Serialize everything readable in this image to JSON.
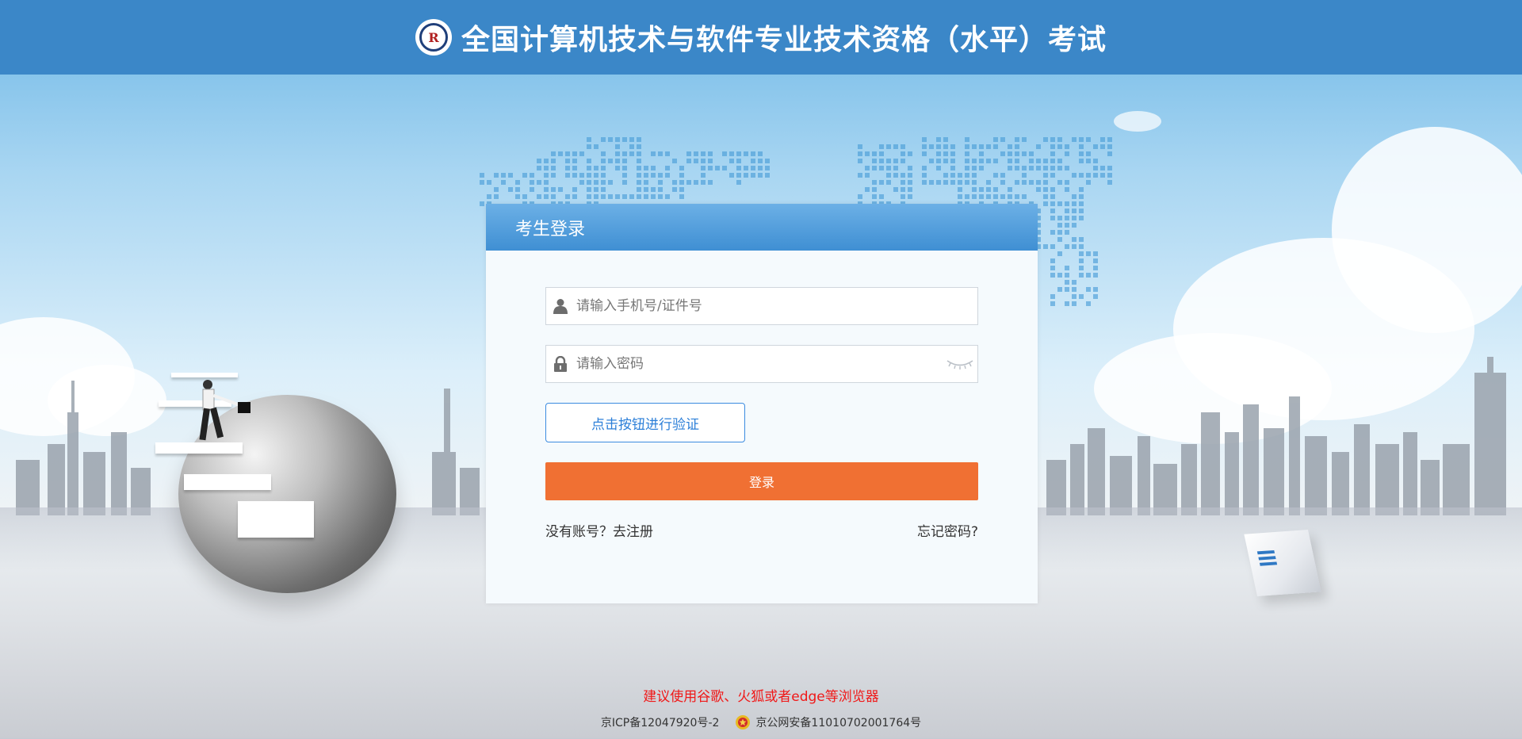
{
  "header": {
    "title": "全国计算机技术与软件专业技术资格（水平）考试",
    "logo_text": "R",
    "logo_icon": "exam-logo-icon"
  },
  "login": {
    "title": "考生登录",
    "account_placeholder": "请输入手机号/证件号",
    "password_placeholder": "请输入密码",
    "verify_button": "点击按钮进行验证",
    "login_button": "登录",
    "register_link": "没有账号？去注册",
    "forgot_link": "忘记密码?"
  },
  "footer": {
    "browser_notice": "建议使用谷歌、火狐或者edge等浏览器",
    "icp": "京ICP备12047920号-2",
    "police_record": "京公网安备11010702001764号"
  },
  "colors": {
    "header_bg": "#3b87c8",
    "login_button": "#f07033",
    "verify_border": "#3b8be0",
    "notice_text": "#f01818"
  },
  "icons": [
    "user-icon",
    "lock-icon",
    "eye-closed-icon",
    "police-badge-icon"
  ]
}
